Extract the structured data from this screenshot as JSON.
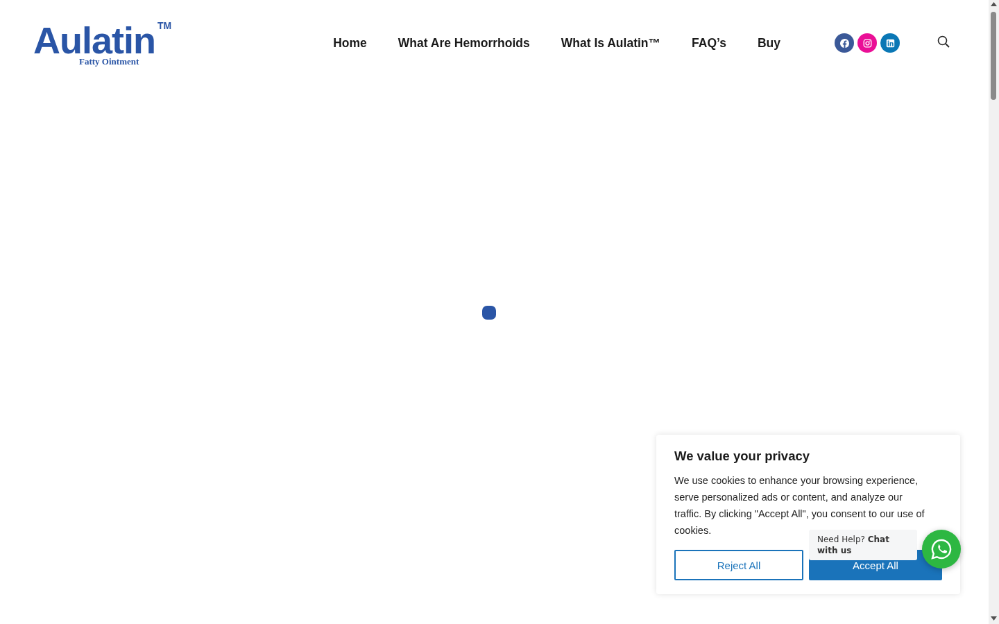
{
  "logo": {
    "name": "Aulatin",
    "mark": "TM",
    "tagline": "Fatty Ointment"
  },
  "nav": [
    {
      "label": "Home"
    },
    {
      "label": "What Are Hemorrhoids"
    },
    {
      "label": "What Is Aulatin™"
    },
    {
      "label": "FAQ’s"
    },
    {
      "label": "Buy"
    }
  ],
  "social": [
    {
      "kind": "facebook",
      "color": "#3b5998"
    },
    {
      "kind": "instagram",
      "color": "#ea0f96"
    },
    {
      "kind": "linkedin",
      "color": "#0a77b5"
    }
  ],
  "cookie_banner": {
    "title": "We value your privacy",
    "text": "We use cookies to enhance your browsing experience, serve personalized ads or content, and analyze our traffic. By clicking \"Accept All\", you consent to our use of cookies.",
    "buttons": [
      {
        "label": "Reject All",
        "kind": "outline"
      },
      {
        "label": "Accept All",
        "kind": "filled"
      }
    ]
  },
  "chat": {
    "text": "Need Help? **Chat with us**"
  }
}
